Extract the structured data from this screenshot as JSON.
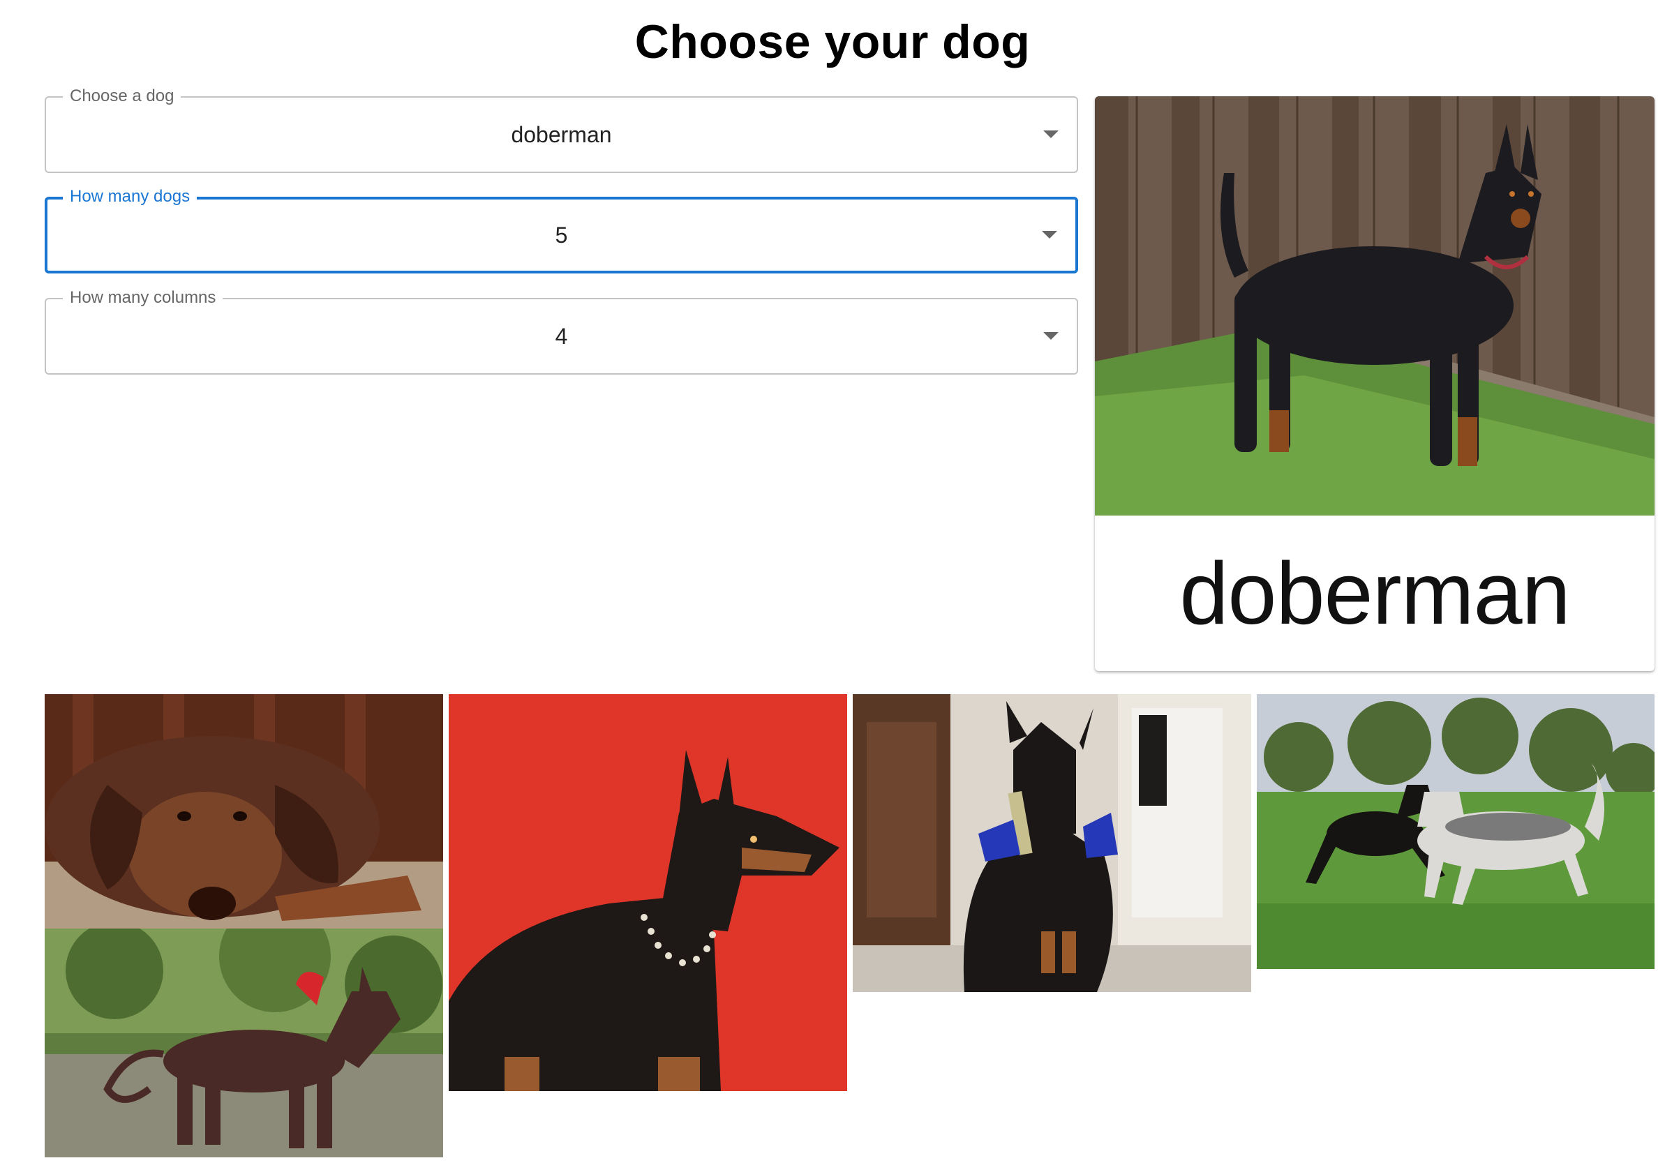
{
  "header": {
    "title": "Choose your dog"
  },
  "form": {
    "breed": {
      "label": "Choose a dog",
      "value": "doberman"
    },
    "count": {
      "label": "How many dogs",
      "value": "5"
    },
    "columns": {
      "label": "How many columns",
      "value": "4"
    }
  },
  "card": {
    "caption": "doberman"
  },
  "gallery": {
    "images": [
      {
        "name": "doberman-lying-on-blanket"
      },
      {
        "name": "doberman-with-spiked-collar-red-background"
      },
      {
        "name": "doberman-sitting-holding-stick"
      },
      {
        "name": "doberman-running-with-husky"
      },
      {
        "name": "red-doberman-standing-in-yard"
      }
    ]
  }
}
